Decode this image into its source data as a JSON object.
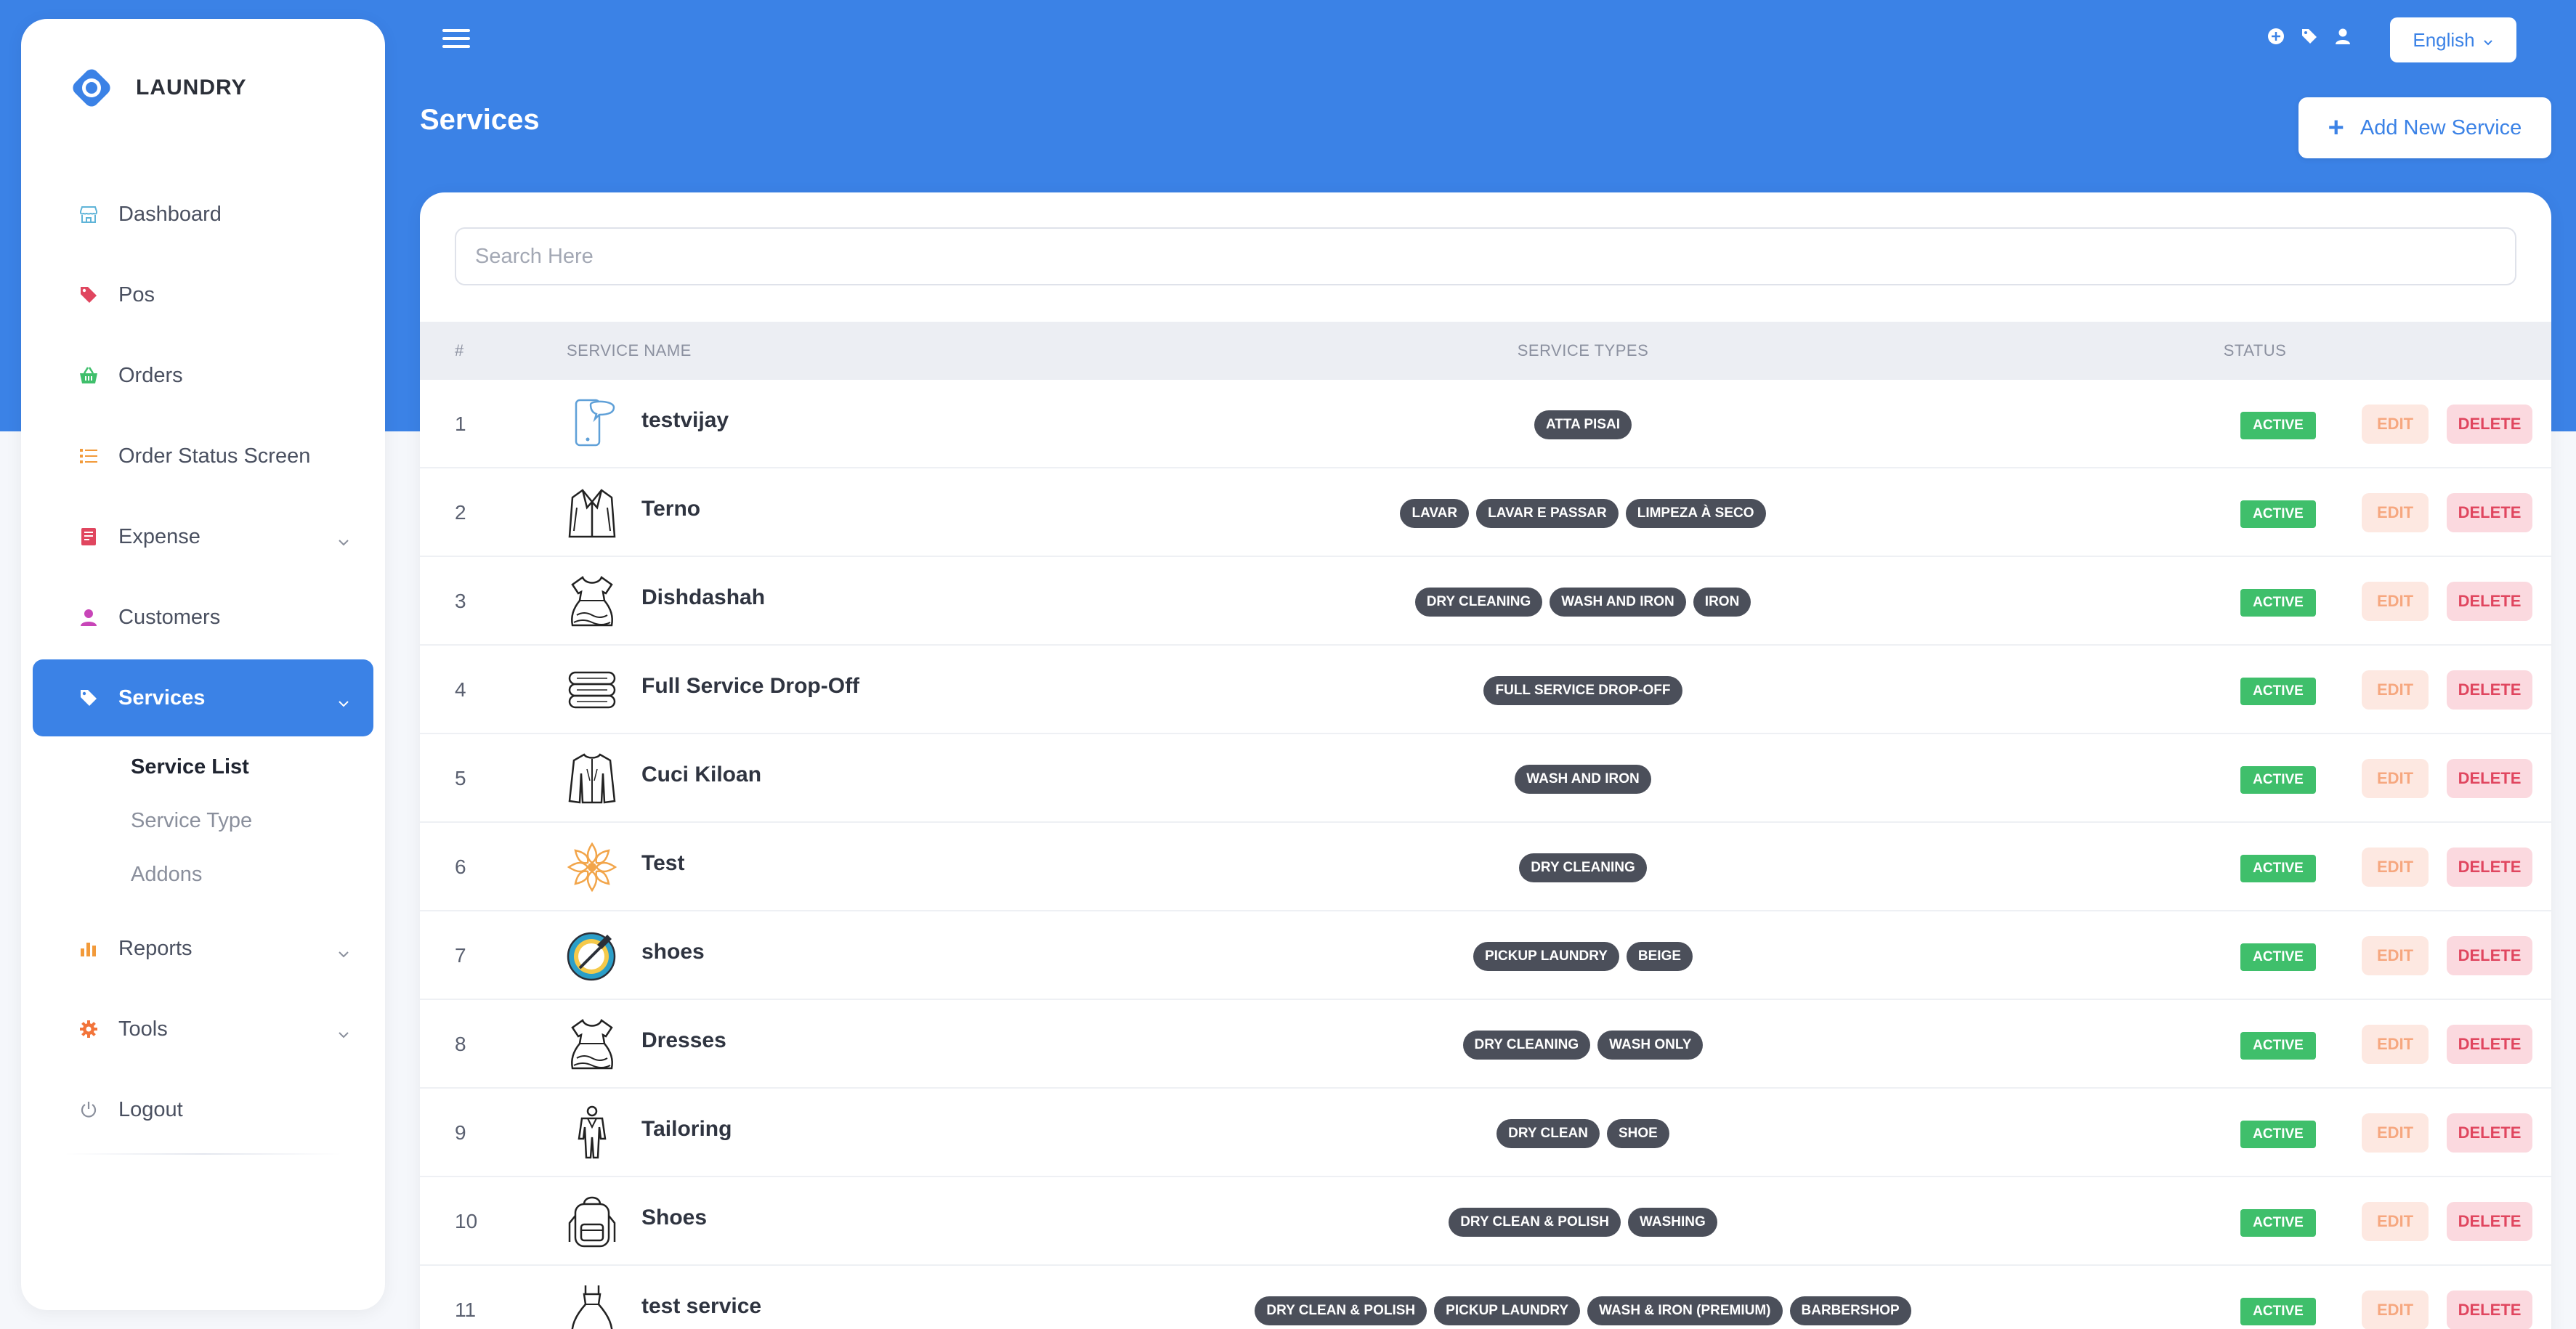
{
  "app": {
    "brand": "LAUNDRY"
  },
  "sidebar": {
    "items": [
      {
        "label": "Dashboard",
        "icon": "store-icon",
        "color": "#5fb4d8"
      },
      {
        "label": "Pos",
        "icon": "tag-icon",
        "color": "#e0465f"
      },
      {
        "label": "Orders",
        "icon": "basket-icon",
        "color": "#3fbf6b"
      },
      {
        "label": "Order Status Screen",
        "icon": "list-icon",
        "color": "#f29a3a"
      },
      {
        "label": "Expense",
        "icon": "receipt-icon",
        "color": "#e0465f"
      },
      {
        "label": "Customers",
        "icon": "user-icon",
        "color": "#c845b8"
      },
      {
        "label": "Services",
        "icon": "tag-icon",
        "color": "#ffffff"
      },
      {
        "label": "Reports",
        "icon": "bar-chart-icon",
        "color": "#f29a3a"
      },
      {
        "label": "Tools",
        "icon": "gear-icon",
        "color": "#f2743a"
      },
      {
        "label": "Logout",
        "icon": "power-icon",
        "color": "#8a8f9c"
      }
    ],
    "submenu": [
      "Service List",
      "Service Type",
      "Addons"
    ]
  },
  "header": {
    "language": "English",
    "page_title": "Services",
    "add_button": "Add New Service"
  },
  "search": {
    "placeholder": "Search Here"
  },
  "table": {
    "headers": [
      "#",
      "Service Name",
      "Service Types",
      "Status"
    ],
    "rows": [
      {
        "idx": "1",
        "name": "testvijay",
        "icon": "phone-chat-icon",
        "types": [
          "ATTA PISAI"
        ],
        "status": "ACTIVE"
      },
      {
        "idx": "2",
        "name": "Terno",
        "icon": "suit-jacket-icon",
        "types": [
          "LAVAR",
          "LAVAR E PASSAR",
          "LIMPEZA À SECO"
        ],
        "status": "ACTIVE"
      },
      {
        "idx": "3",
        "name": "Dishdashah",
        "icon": "dress-icon",
        "types": [
          "DRY CLEANING",
          "WASH AND IRON",
          "IRON"
        ],
        "status": "ACTIVE"
      },
      {
        "idx": "4",
        "name": "Full Service Drop-Off",
        "icon": "folded-towels-icon",
        "types": [
          "FULL SERVICE DROP-OFF"
        ],
        "status": "ACTIVE"
      },
      {
        "idx": "5",
        "name": "Cuci Kiloan",
        "icon": "jacket-icon",
        "types": [
          "WASH AND IRON"
        ],
        "status": "ACTIVE"
      },
      {
        "idx": "6",
        "name": "Test",
        "icon": "flower-icon",
        "types": [
          "DRY CLEANING"
        ],
        "status": "ACTIVE"
      },
      {
        "idx": "7",
        "name": "shoes",
        "icon": "compass-icon",
        "types": [
          "PICKUP LAUNDRY",
          "BEIGE"
        ],
        "status": "ACTIVE"
      },
      {
        "idx": "8",
        "name": "Dresses",
        "icon": "dress-icon",
        "types": [
          "DRY CLEANING",
          "WASH ONLY"
        ],
        "status": "ACTIVE"
      },
      {
        "idx": "9",
        "name": "Tailoring",
        "icon": "mannequin-icon",
        "types": [
          "DRY CLEAN",
          "SHOE"
        ],
        "status": "ACTIVE"
      },
      {
        "idx": "10",
        "name": "Shoes",
        "icon": "backpack-icon",
        "types": [
          "DRY CLEAN & POLISH",
          "WASHING"
        ],
        "status": "ACTIVE"
      },
      {
        "idx": "11",
        "name": "test service",
        "icon": "gown-icon",
        "types": [
          "DRY CLEAN & POLISH",
          "PICKUP LAUNDRY",
          "WASH & IRON (PREMIUM)",
          "BARBERSHOP"
        ],
        "status": "ACTIVE"
      }
    ],
    "edit_label": "EDIT",
    "delete_label": "DELETE"
  },
  "colors": {
    "accent": "#3b82e6",
    "active": "#3fbf6b",
    "edit_bg": "#fde8e1",
    "delete_bg": "#fbd9df",
    "pill": "#4b4f5a"
  }
}
